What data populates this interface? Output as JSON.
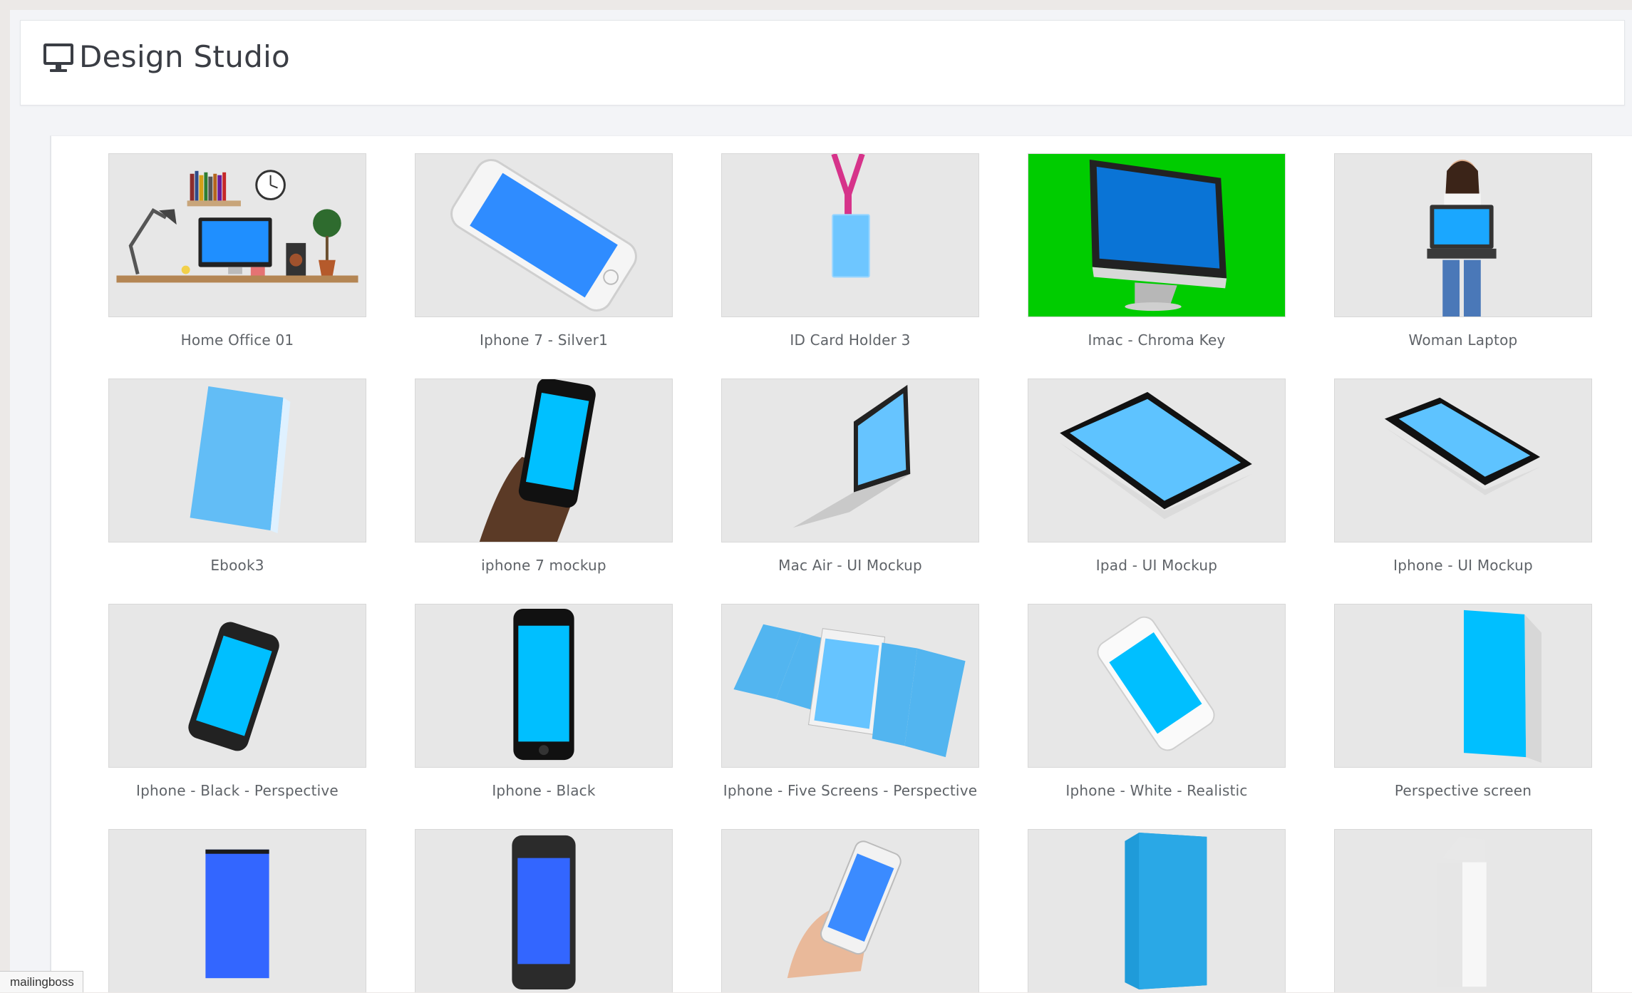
{
  "header": {
    "title": "Design Studio",
    "icon": "monitor-icon"
  },
  "gallery": {
    "rows": [
      [
        "Home Office 01",
        "Iphone 7 - Silver1",
        "ID Card Holder 3",
        "Imac - Chroma Key",
        "Woman Laptop"
      ],
      [
        "Ebook3",
        "iphone 7 mockup",
        "Mac Air - UI Mockup",
        "Ipad - UI Mockup",
        "Iphone - UI Mockup"
      ],
      [
        "Iphone - Black - Perspective",
        "Iphone - Black",
        "Iphone - Five Screens - Perspective",
        "Iphone - White - Realistic",
        "Perspective screen"
      ],
      [
        "",
        "",
        "",
        "",
        ""
      ]
    ],
    "accent_colors": {
      "screen_blue": "#3b8bff",
      "screen_cyan": "#00bfff",
      "chroma_green": "#00cc00"
    }
  },
  "status_bar": {
    "text": "mailingboss"
  }
}
